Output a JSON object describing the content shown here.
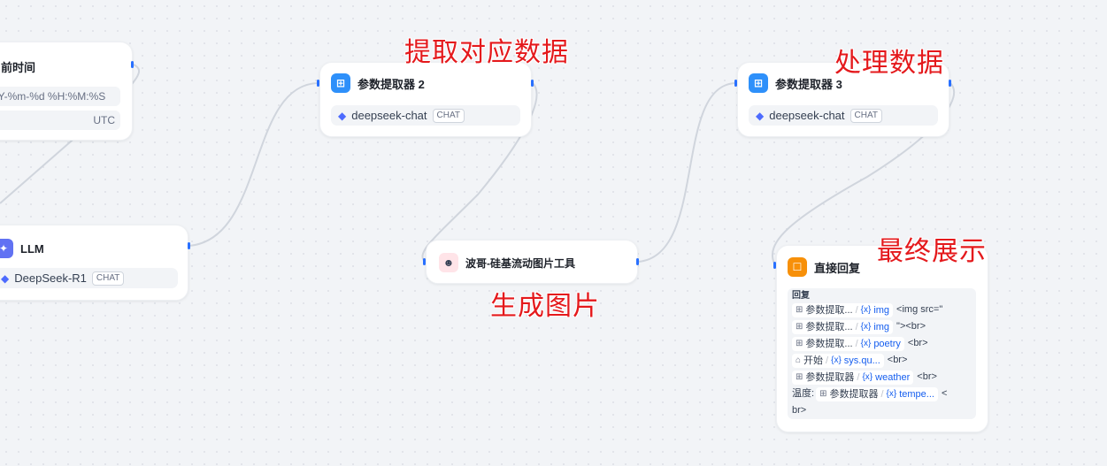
{
  "nodes": {
    "time": {
      "title": "前时间",
      "format": "%Y-%m-%d %H:%M:%S",
      "timezone": "UTC"
    },
    "llm": {
      "title": "LLM",
      "model": "DeepSeek-R1",
      "badge": "CHAT"
    },
    "param2": {
      "title": "参数提取器 2",
      "model": "deepseek-chat",
      "badge": "CHAT"
    },
    "tool": {
      "title": "波哥-硅基流动图片工具"
    },
    "param3": {
      "title": "参数提取器 3",
      "model": "deepseek-chat",
      "badge": "CHAT"
    },
    "answer": {
      "title": "直接回复",
      "reply_label": "回复",
      "lines": [
        {
          "node": "参数提取...",
          "var": "img",
          "text": "<img src=\""
        },
        {
          "node": "参数提取...",
          "var": "img",
          "text": "\"><br>"
        },
        {
          "node": "参数提取...",
          "var": "poetry",
          "text": "<br>"
        },
        {
          "node": "开始",
          "var": "sys.qu...",
          "text": "<br>"
        },
        {
          "node": "参数提取器",
          "var": "weather",
          "text": "<br>"
        }
      ],
      "last_line_prefix": "温度:",
      "last_line_node": "参数提取器",
      "last_line_var": "tempe...",
      "last_line_text": "<",
      "last_line_wrap": "br>"
    }
  },
  "annotations": {
    "extract": "提取对应数据",
    "process": "处理数据",
    "generate": "生成图片",
    "final": "最终展示"
  },
  "colors": {
    "accent": "#2970ff",
    "annotation": "#e4191c",
    "wire": "#d0d5dd"
  }
}
